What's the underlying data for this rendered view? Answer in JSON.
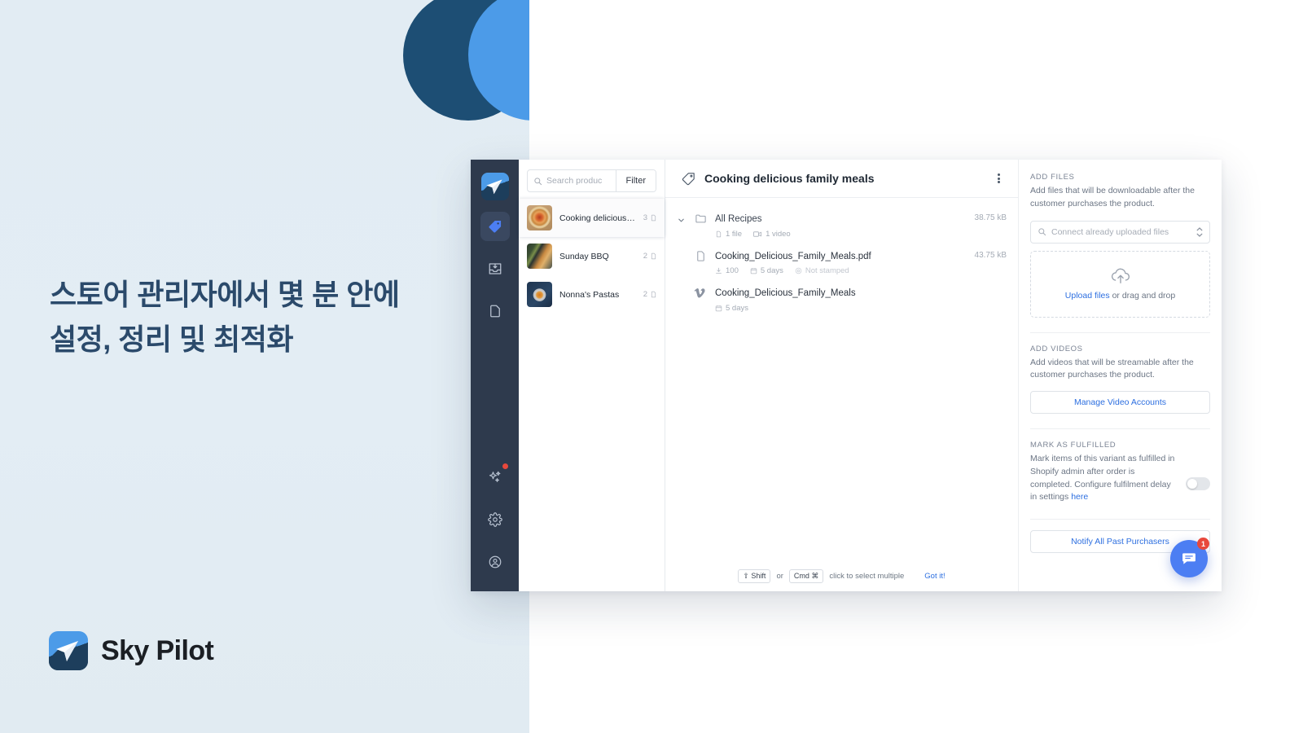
{
  "marketing": {
    "headline": "스토어 관리자에서 몇 분 안에 설정, 정리 및 최적화",
    "brand_name": "Sky Pilot",
    "colors": {
      "background": "#e2ecf3",
      "circle_dark": "#1d4e74",
      "circle_light": "#4c9be8",
      "headline_text": "#2b4a6b"
    }
  },
  "app": {
    "nav_rail": {
      "items": [
        {
          "name": "logo",
          "icon": "sky-pilot-logo-icon",
          "active": false
        },
        {
          "name": "products",
          "icon": "tag-icon",
          "active": true
        },
        {
          "name": "imports",
          "icon": "inbox-download-icon",
          "active": false
        },
        {
          "name": "pages",
          "icon": "document-icon",
          "active": false
        },
        {
          "name": "magic",
          "icon": "sparkles-icon",
          "active": false,
          "badge": true
        },
        {
          "name": "settings",
          "icon": "gear-icon",
          "active": false
        },
        {
          "name": "account",
          "icon": "user-circle-icon",
          "active": false
        }
      ]
    },
    "product_panel": {
      "search": {
        "placeholder": "Search produc",
        "value": "",
        "icon": "search-icon"
      },
      "filter_label": "Filter",
      "products": [
        {
          "name": "Cooking delicious f...",
          "count": "3",
          "count_icon": "file-icon",
          "selected": true,
          "thumb": "pizza"
        },
        {
          "name": "Sunday BBQ",
          "count": "2",
          "count_icon": "file-icon",
          "selected": false,
          "thumb": "bbq"
        },
        {
          "name": "Nonna's Pastas",
          "count": "2",
          "count_icon": "file-icon",
          "selected": false,
          "thumb": "pasta"
        }
      ]
    },
    "main": {
      "title": "Cooking delicious family meals",
      "title_icon": "tag-icon",
      "menu_icon": "kebab-menu-icon",
      "rows": [
        {
          "type": "folder",
          "icon": "folder-icon",
          "name": "All Recipes",
          "size": "38.75 kB",
          "meta": [
            {
              "icon": "file-icon",
              "text": "1 file",
              "muted": false
            },
            {
              "icon": "video-icon",
              "text": "1 video",
              "muted": false
            }
          ]
        },
        {
          "type": "file",
          "icon": "file-icon",
          "name": "Cooking_Delicious_Family_Meals.pdf",
          "size": "43.75 kB",
          "meta": [
            {
              "icon": "download-icon",
              "text": "100",
              "muted": false
            },
            {
              "icon": "calendar-icon",
              "text": "5 days",
              "muted": false
            },
            {
              "icon": "stamp-icon",
              "text": "Not stamped",
              "muted": true
            }
          ]
        },
        {
          "type": "video",
          "icon": "vimeo-icon",
          "name": "Cooking_Delicious_Family_Meals",
          "size": "",
          "meta": [
            {
              "icon": "calendar-icon",
              "text": "5 days",
              "muted": false
            }
          ]
        }
      ],
      "hint": {
        "key_shift": "⇧ Shift",
        "conjunction": "or",
        "key_cmd": "Cmd ⌘",
        "text": "click to select multiple",
        "dismiss": "Got it!"
      }
    },
    "right_panel": {
      "add_files": {
        "label": "ADD FILES",
        "description": "Add files that will be downloadable after the customer purchases the product.",
        "connect_placeholder": "Connect already uploaded files",
        "connect_icon": "search-icon",
        "dropzone_icon": "cloud-upload-icon",
        "dropzone_link": "Upload files",
        "dropzone_rest": " or drag and drop"
      },
      "add_videos": {
        "label": "ADD VIDEOS",
        "description": "Add videos that will be streamable after the customer purchases the product.",
        "button_label": "Manage Video Accounts"
      },
      "mark_fulfilled": {
        "label": "MARK AS FULFILLED",
        "description": "Mark items of this variant as fulfilled in Shopify admin after order is completed. Configure fulfilment delay in settings ",
        "link": "here",
        "toggle_on": false
      },
      "notify": {
        "button_label": "Notify All Past Purchasers"
      }
    },
    "chat": {
      "icon": "chat-bubble-icon",
      "badge_count": "1",
      "color": "#4c7ef3",
      "badge_color": "#e8483c"
    }
  }
}
